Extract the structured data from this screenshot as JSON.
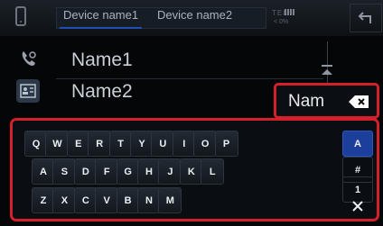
{
  "header": {
    "tabs": [
      "Device name1",
      "Device name2"
    ],
    "status_signal": "TEL",
    "status_sub": "< 0%"
  },
  "contacts": [
    {
      "name": "Name1"
    },
    {
      "name": "Name2"
    }
  ],
  "search": {
    "value": "Nam"
  },
  "keyboard": {
    "row1": [
      "Q",
      "W",
      "E",
      "R",
      "T",
      "Y",
      "U",
      "I",
      "O",
      "P"
    ],
    "row2": [
      "A",
      "S",
      "D",
      "F",
      "G",
      "H",
      "J",
      "K",
      "L"
    ],
    "row3": [
      "Z",
      "X",
      "C",
      "V",
      "B",
      "N",
      "M"
    ],
    "modes": [
      "A",
      "#",
      "1"
    ]
  },
  "icons": {
    "back": "back-arrow-icon",
    "phone": "smartphone-icon",
    "call": "call-history-icon",
    "phonebook": "phonebook-icon",
    "scroll_top": "scroll-to-top-icon",
    "backspace": "backspace-icon",
    "close": "close-icon"
  },
  "colors": {
    "highlight": "#d3202a",
    "accent": "#1d3f9c"
  }
}
